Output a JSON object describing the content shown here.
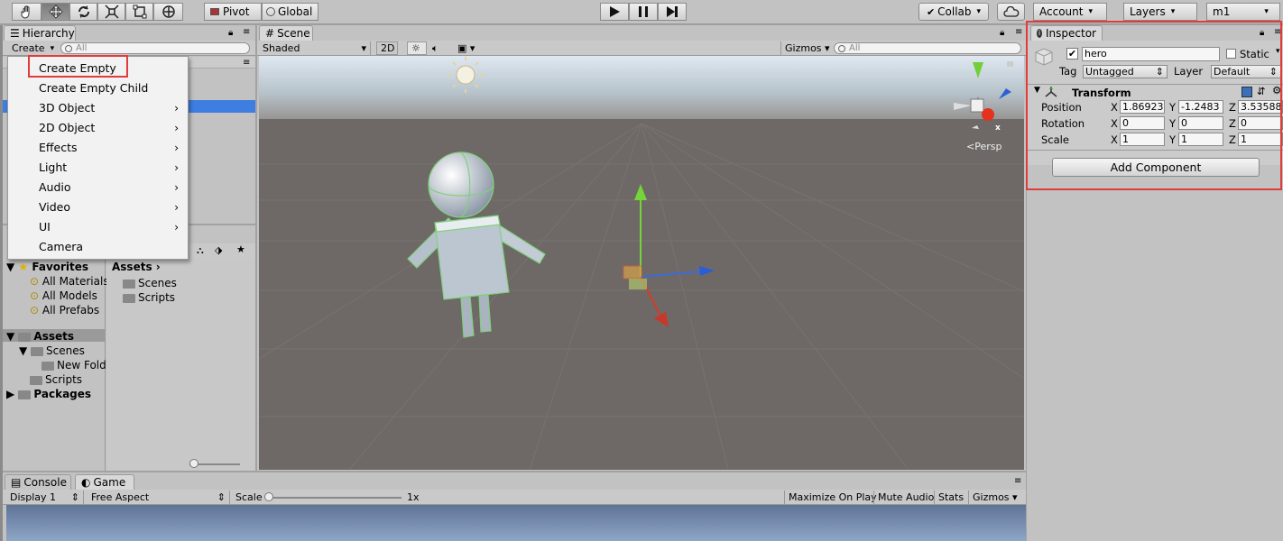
{
  "toolbar": {
    "tools": [
      "hand-tool-icon",
      "move-tool-icon",
      "rotate-tool-icon",
      "scale-tool-icon",
      "rect-tool-icon",
      "transform-tool-icon"
    ],
    "pivot": "Pivot",
    "global": "Global",
    "collab": "Collab",
    "account": "Account",
    "layers": "Layers",
    "layout": "m1"
  },
  "hierarchy": {
    "tab": "Hierarchy",
    "create": "Create",
    "search_placeholder": "All"
  },
  "context_menu": {
    "items": [
      {
        "label": "Create Empty",
        "submenu": false
      },
      {
        "label": "Create Empty Child",
        "submenu": false
      },
      {
        "label": "3D Object",
        "submenu": true
      },
      {
        "label": "2D Object",
        "submenu": true
      },
      {
        "label": "Effects",
        "submenu": true
      },
      {
        "label": "Light",
        "submenu": true
      },
      {
        "label": "Audio",
        "submenu": true
      },
      {
        "label": "Video",
        "submenu": true
      },
      {
        "label": "UI",
        "submenu": true
      },
      {
        "label": "Camera",
        "submenu": false
      }
    ],
    "arrow": "›"
  },
  "project": {
    "favorites": "Favorites",
    "fav_items": [
      "All Materials",
      "All Models",
      "All Prefabs"
    ],
    "assets": "Assets",
    "assets_tree": [
      "Scenes",
      "New Fold",
      "Scripts"
    ],
    "packages": "Packages",
    "breadcrumb": "Assets",
    "content": [
      "Scenes",
      "Scripts"
    ]
  },
  "scene": {
    "tab": "Scene",
    "shading": "Shaded",
    "mode2d": "2D",
    "gizmos": "Gizmos",
    "search_placeholder": "All",
    "persp": "Persp",
    "axis_x": "x"
  },
  "inspector": {
    "tab": "Inspector",
    "name": "hero",
    "static": "Static",
    "tag_label": "Tag",
    "tag": "Untagged",
    "layer_label": "Layer",
    "layer": "Default",
    "transform": "Transform",
    "rows": [
      {
        "label": "Position",
        "x": "1.86923",
        "y": "-1.2483",
        "z": "3.53588"
      },
      {
        "label": "Rotation",
        "x": "0",
        "y": "0",
        "z": "0"
      },
      {
        "label": "Scale",
        "x": "1",
        "y": "1",
        "z": "1"
      }
    ],
    "axis": {
      "x": "X",
      "y": "Y",
      "z": "Z"
    },
    "add_component": "Add Component"
  },
  "game": {
    "console_tab": "Console",
    "game_tab": "Game",
    "display": "Display 1",
    "aspect": "Free Aspect",
    "scale_label": "Scale",
    "scale_value": "1x",
    "maximize": "Maximize On Play",
    "mute": "Mute Audio",
    "stats": "Stats",
    "gizmos": "Gizmos"
  },
  "colors": {
    "highlight": "#e23b3b",
    "selection": "#3d7ee0"
  }
}
